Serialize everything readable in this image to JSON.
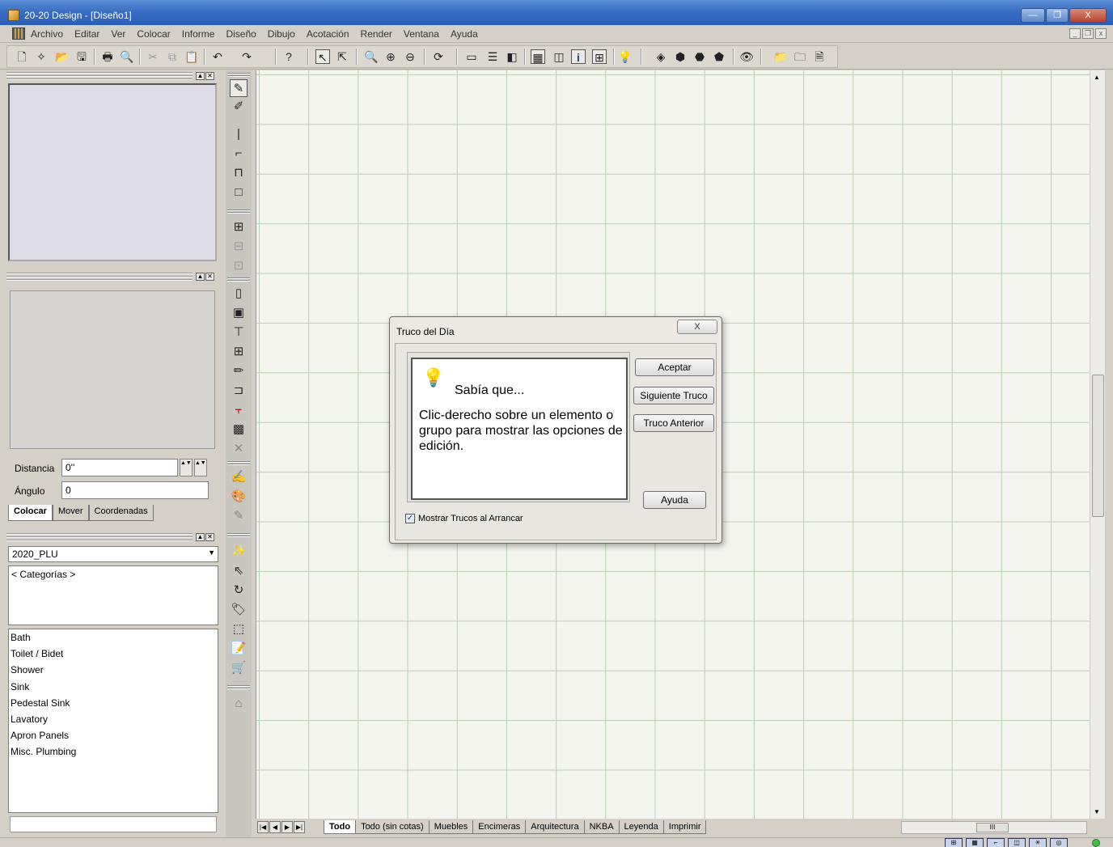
{
  "window": {
    "title": "20-20 Design - [Diseño1]",
    "controls": {
      "minimize": "—",
      "restore": "❐",
      "close": "X"
    }
  },
  "menu": {
    "items": [
      "Archivo",
      "Editar",
      "Ver",
      "Colocar",
      "Informe",
      "Diseño",
      "Dibujo",
      "Acotación",
      "Render",
      "Ventana",
      "Ayuda"
    ],
    "mdi_controls": [
      "_",
      "❐",
      "x"
    ]
  },
  "left_panel": {
    "distance_label": "Distancia",
    "distance_value": "0''",
    "angle_label": "Ángulo",
    "angle_value": "0",
    "tabs": [
      "Colocar",
      "Mover",
      "Coordenadas"
    ],
    "active_tab": "Colocar",
    "catalog_selected": "2020_PLU",
    "categories_header": "< Categorías >",
    "categories": [
      "Bath",
      "Toilet / Bidet",
      "Shower",
      "Sink",
      "Pedestal Sink",
      "Lavatory",
      "Apron Panels",
      "Misc. Plumbing"
    ]
  },
  "sheet_tabs": {
    "nav": [
      "|◀",
      "◀",
      "▶",
      "▶|"
    ],
    "items": [
      "Todo",
      "Todo (sin cotas)",
      "Muebles",
      "Encimeras",
      "Arquitectura",
      "NKBA",
      "Leyenda",
      "Imprimir"
    ],
    "active": "Todo",
    "scroll_thumb": "III"
  },
  "dialog": {
    "title": "Truco del Día",
    "close_label": "X",
    "tip_heading": "Sabía que...",
    "tip_text": "Clic-derecho sobre un elemento o grupo para mostrar las opciones de edición.",
    "buttons": {
      "accept": "Aceptar",
      "next": "Siguiente Truco",
      "previous": "Truco Anterior",
      "help": "Ayuda"
    },
    "checkbox_label": "Mostrar Trucos al Arrancar",
    "checkbox_checked": true
  },
  "icons": {
    "toolbar": [
      "new-file-icon",
      "new-wizard-icon",
      "open-folder-icon",
      "save-icon",
      "print-icon",
      "print-preview-icon",
      "cut-icon",
      "copy-icon",
      "paste-icon",
      "undo-icon",
      "redo-icon",
      "help-pointer-icon",
      "select-icon",
      "select-group-icon",
      "zoom-icon",
      "zoom-in-icon",
      "zoom-out-icon",
      "refresh-icon",
      "plan-view-icon",
      "list-view-icon",
      "panel-icon",
      "grid-view-icon",
      "window-icon",
      "info-icon",
      "properties-icon",
      "light-icon",
      "render-cube-icon",
      "render-solid-icon",
      "render-shaded-icon",
      "render-dark-icon",
      "eye-icon",
      "open-catalog-icon",
      "catalog-icon",
      "report-icon"
    ]
  }
}
